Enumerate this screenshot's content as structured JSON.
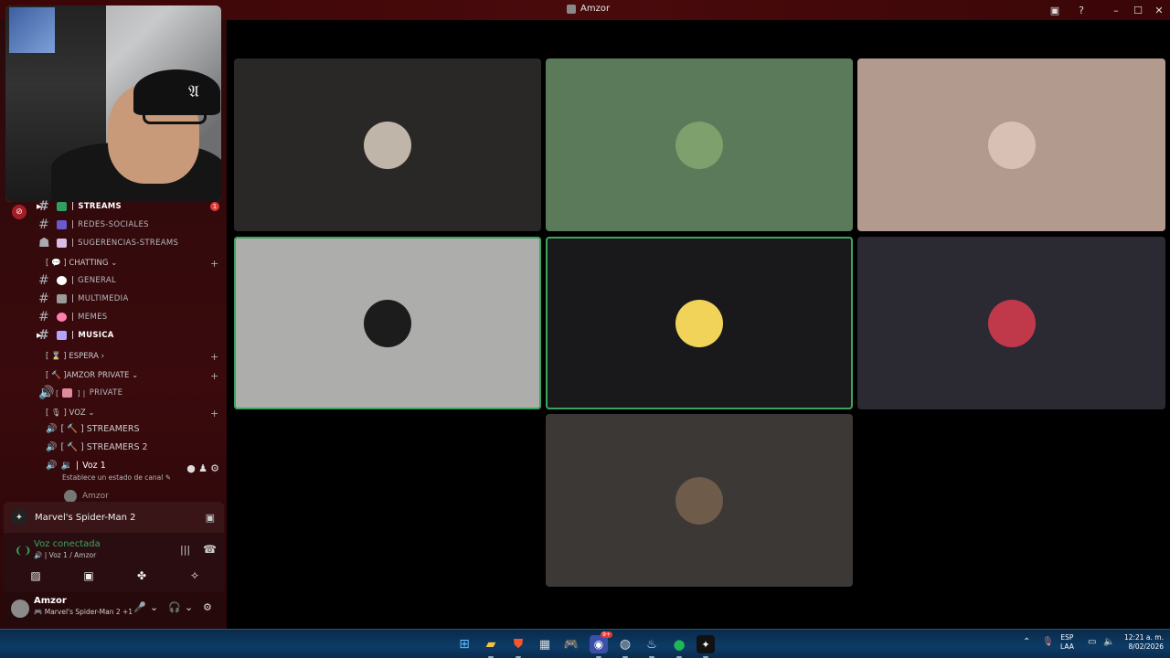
{
  "window": {
    "title": "Amzor"
  },
  "channels": [
    {
      "label": "STREAMS",
      "color": "#2e9e62",
      "badge": "1",
      "active": true
    },
    {
      "label": "REDES-SOCIALES",
      "color": "#6a5acd"
    },
    {
      "label": "SUGERENCIAS-STREAMS",
      "color": "#d8bde5"
    }
  ],
  "categories": {
    "chatting": "[ 💬 ] CHATTING",
    "espera": "[ ⌛ ] ESPERA",
    "private": "[ 🔨 ]AMZOR PRIVATE",
    "voz": "[ 🎙 ] VOZ"
  },
  "chatting_channels": [
    {
      "label": "GENERAL",
      "color": "#ffffff"
    },
    {
      "label": "MULTIMEDIA",
      "color": "#9a9a9a"
    },
    {
      "label": "MEMES",
      "color": "#ff7fb0"
    },
    {
      "label": "MUSICA",
      "color": "#b3a5ff",
      "active": true
    }
  ],
  "private_channel": "PRIVATE",
  "voice_channels": [
    {
      "label": "[ 🔨 ] STREAMERS"
    },
    {
      "label": "[ 🔨 ] STREAMERS 2"
    },
    {
      "label": "Voz 1",
      "active": true
    }
  ],
  "voice_status_hint": "Establece un estado de canal",
  "voice_member": "Amzor",
  "activity": {
    "game": "Marvel's Spider-Man 2"
  },
  "voice_connected": {
    "title": "Voz conectada",
    "subtitle": "Voz 1 / Amzor"
  },
  "user": {
    "name": "Amzor",
    "status": "Marvel's Spider-Man 2 +1"
  },
  "tiles": [
    {
      "bg": "#2a2826",
      "avatar_bg": "#bfb6a9",
      "speaking": false
    },
    {
      "bg": "#5b7a59",
      "avatar_bg": "#7da06d",
      "speaking": false
    },
    {
      "bg": "#b39a8f",
      "avatar_bg": "#d9c0b5",
      "speaking": false
    },
    {
      "bg": "#adaeab",
      "avatar_bg": "#1c1c1c",
      "speaking": true
    },
    {
      "bg": "#19181b",
      "avatar_bg": "#f2d35a",
      "speaking": true
    },
    {
      "bg": "#2b2a33",
      "avatar_bg": "#c0394a",
      "speaking": false
    },
    {
      "bg": "#3b3835",
      "avatar_bg": "#6e5b4a",
      "speaking": false
    }
  ],
  "taskbar": {
    "lang_1": "ESP",
    "lang_2": "LAA",
    "time": "12:21 a. m.",
    "date": "8/02/2026",
    "discord_badge": "9+"
  }
}
